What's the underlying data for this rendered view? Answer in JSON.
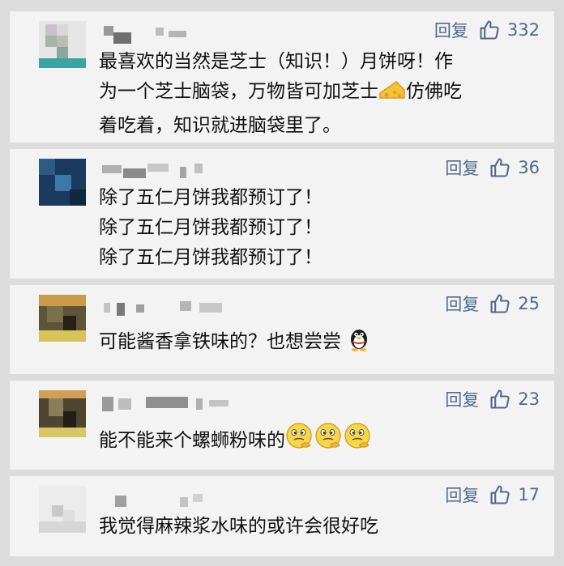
{
  "comments": [
    {
      "reply_label": "回复",
      "likes": "332",
      "lines": [
        "最喜欢的当然是芝士（知识！）月饼呀！作",
        "为一个芝士脑袋，万物皆可加芝士",
        "仿佛吃",
        "着吃着，知识就进脑袋里了。"
      ],
      "emoji": "cheese-emoji"
    },
    {
      "reply_label": "回复",
      "likes": "36",
      "lines": [
        "除了五仁月饼我都预订了！",
        "除了五仁月饼我都预订了！",
        "除了五仁月饼我都预订了！"
      ]
    },
    {
      "reply_label": "回复",
      "likes": "25",
      "lines": [
        "可能酱香拿铁味的？也想尝尝"
      ],
      "emoji": "penguin-emoji"
    },
    {
      "reply_label": "回复",
      "likes": "23",
      "lines": [
        "能不能来个螺蛳粉味的"
      ],
      "emoji": "thinking-face-emoji"
    },
    {
      "reply_label": "回复",
      "likes": "17",
      "lines": [
        "我觉得麻辣浆水味的或许会很好吃"
      ]
    }
  ],
  "colors": {
    "background": "#dcdcdc",
    "card": "#f3f3f3",
    "action": "#516a8c",
    "text": "#111111"
  },
  "icons": {
    "like": "thumbs-up-icon"
  }
}
